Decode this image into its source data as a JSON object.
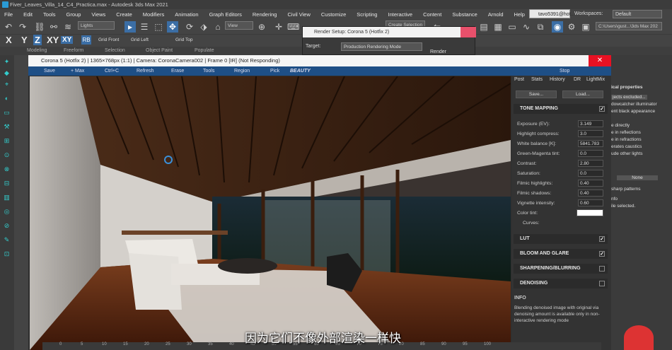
{
  "titlebar": {
    "text": "Fiver_Leaves_Villa_14_C4_Practica.max - Autodesk 3ds Max 2021"
  },
  "menu": [
    "File",
    "Edit",
    "Tools",
    "Group",
    "Views",
    "Create",
    "Modifiers",
    "Animation",
    "Graph Editors",
    "Rendering",
    "Civil View",
    "Customize",
    "Scripting",
    "Interactive",
    "Content",
    "Substance",
    "Arnold",
    "Help"
  ],
  "user": "tavo5391@hot...",
  "workspaces_label": "Workspaces:",
  "workspace": "Default",
  "toolbar": {
    "layer_dropdown": "Lights",
    "view_dropdown": "View",
    "path": "C:\\Users\\gust...\\3ds Max 202",
    "selection_set": "Create Selection Set"
  },
  "axes": {
    "x": "X",
    "y": "Y",
    "z": "Z",
    "xy": "XY",
    "xy2": "XY",
    "grid_front": "Grid Front",
    "grid_left": "Grid Left",
    "grid_top": "Grid Top"
  },
  "ribbon": [
    "Modeling",
    "Freeform",
    "Selection",
    "Object Paint",
    "Populate"
  ],
  "render_setup": {
    "title": "Render Setup: Corona 5 (Hotfix 2)",
    "target_label": "Target:",
    "target": "Production Rendering Mode",
    "render_btn": "Render"
  },
  "vfb": {
    "title": "Corona 5 (Hotfix 2) | 1365×768px (1:1) | Camera: CoronaCamera002 | Frame 0 [IR] (Not Responding)",
    "toolbar": [
      "Save",
      "+ Max",
      "Ctrl+C",
      "Refresh",
      "Erase",
      "Tools",
      "Region",
      "Pick",
      "BEAUTY",
      "Stop"
    ]
  },
  "side": {
    "tabs": [
      "Post",
      "Stats",
      "History",
      "DR",
      "LightMix"
    ],
    "save": "Save...",
    "load": "Load...",
    "tone_mapping": "TONE MAPPING",
    "params": [
      {
        "label": "Exposure (EV):",
        "value": "3.149"
      },
      {
        "label": "Highlight compress:",
        "value": "3.0"
      },
      {
        "label": "White balance [K]:",
        "value": "5841.783"
      },
      {
        "label": "Green-Magenta tint:",
        "value": "0.0"
      },
      {
        "label": "Contrast:",
        "value": "2.80"
      },
      {
        "label": "Saturation:",
        "value": "0.0"
      },
      {
        "label": "Filmic highlights:",
        "value": "0.40"
      },
      {
        "label": "Filmic shadows:",
        "value": "0.40"
      },
      {
        "label": "Vignette intensity:",
        "value": "0.60"
      }
    ],
    "color_tint": "Color tint:",
    "curves": "Curves:",
    "sections": [
      "LUT",
      "BLOOM AND GLARE",
      "SHARPENING/BLURRING",
      "DENOISING"
    ],
    "info_title": "INFO",
    "info_text": "Blending denoised image with original via denoising amount is available only in non-interactive rendering mode"
  },
  "rightpanel": [
    "ical properties",
    "jects excluded...",
    "dowcatcher illuminator",
    "ent black appearance",
    "e directly",
    "e in reflections",
    "e in refractions",
    "erates caustics",
    "ude other lights",
    "None",
    "sharp patterns",
    "nfo",
    "ile selected."
  ],
  "timeline": [
    "0",
    "5",
    "10",
    "15",
    "20",
    "25",
    "30",
    "35",
    "40",
    "45",
    "50",
    "55",
    "60",
    "65",
    "70",
    "75",
    "80",
    "85",
    "90",
    "95",
    "100"
  ],
  "subtitle": "因为它们不像外部渲染一样快"
}
